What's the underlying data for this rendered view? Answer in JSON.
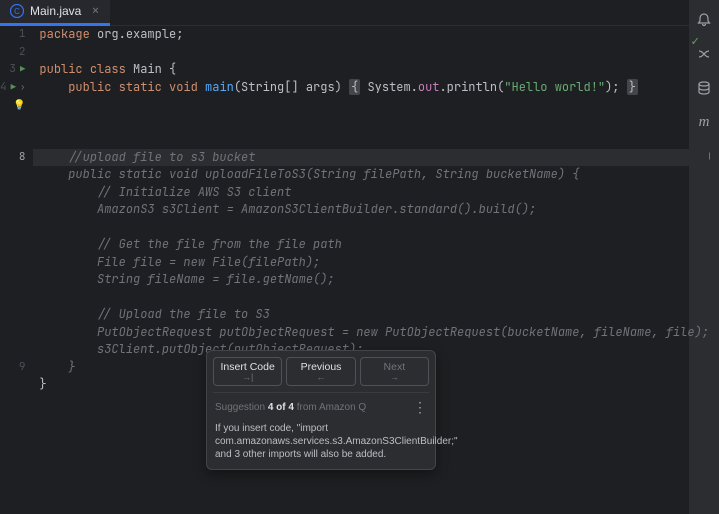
{
  "tab": {
    "filename": "Main.java"
  },
  "gutter": {
    "lines": [
      "1",
      "2",
      "3",
      "4",
      " ",
      " ",
      " ",
      "8",
      " ",
      " ",
      " ",
      " ",
      " ",
      " ",
      " ",
      " ",
      " ",
      " ",
      " ",
      "9"
    ]
  },
  "code": {
    "l1": {
      "kw1": "package",
      "pkg": " org.example;"
    },
    "l3": {
      "kw1": "public class ",
      "name": "Main ",
      "brace": "{"
    },
    "l4": {
      "indent": "    ",
      "kw": "public static void ",
      "fn": "main",
      "args": "(String[] args) ",
      "lbrace": "{",
      "body1": " System.",
      "out": "out",
      "body2": ".println(",
      "str": "\"Hello world!\"",
      "body3": "); ",
      "rbrace": "}"
    },
    "l8": "    //upload file to s3 bucket",
    "s1": "    public static void uploadFileToS3(String filePath, String bucketName) {",
    "s2": "        // Initialize AWS S3 client",
    "s3": "        AmazonS3 s3Client = AmazonS3ClientBuilder.standard().build();",
    "s4": "",
    "s5": "        // Get the file from the file path",
    "s6": "        File file = new File(filePath);",
    "s7": "        String fileName = file.getName();",
    "s8": "",
    "s9": "        // Upload the file to S3",
    "s10": "        PutObjectRequest putObjectRequest = new PutObjectRequest(bucketName, fileName, file);",
    "s11": "        s3Client.putObject(putObjectRequest);",
    "s12": "    }",
    "l9": "}"
  },
  "popup": {
    "insert": "Insert Code",
    "insert_sub": "→|",
    "prev": "Previous",
    "prev_sub": "←",
    "next": "Next",
    "next_sub": "→",
    "info_pre": "Suggestion ",
    "info_num": "4 of 4",
    "info_post": " from Amazon Q",
    "msg": "If you insert code, \"import com.amazonaws.services.s3.AmazonS3ClientBuilder;\" and 3 other imports will also be added."
  }
}
